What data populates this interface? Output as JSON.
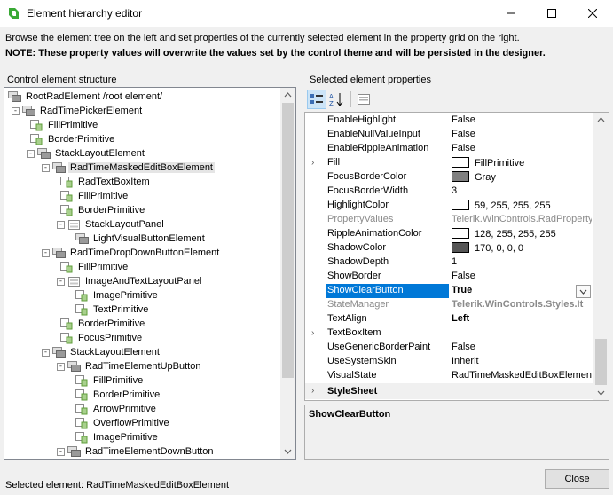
{
  "window": {
    "title": "Element hierarchy editor"
  },
  "description": {
    "line1": "Browse the element tree on the left and set properties of the currently selected element in the property grid on the right.",
    "line2": "NOTE: These property values will overwrite the values set by the control theme and will be persisted in the designer."
  },
  "tree_panel": {
    "label": "Control element structure",
    "items": [
      {
        "label": "RootRadElement /root element/",
        "level": 0,
        "expander": "-",
        "icon": "element-stack-icon"
      },
      {
        "label": "RadTimePickerElement",
        "level": 1,
        "expander": "-",
        "icon": "element-stack-icon"
      },
      {
        "label": "FillPrimitive",
        "level": 2,
        "expander": "",
        "icon": "primitive-icon"
      },
      {
        "label": "BorderPrimitive",
        "level": 2,
        "expander": "",
        "icon": "primitive-icon"
      },
      {
        "label": "StackLayoutElement",
        "level": 2,
        "expander": "-",
        "icon": "element-stack-icon"
      },
      {
        "label": "RadTimeMaskedEditBoxElement",
        "level": 3,
        "expander": "-",
        "icon": "element-stack-icon",
        "selected": true
      },
      {
        "label": "RadTextBoxItem",
        "level": 4,
        "expander": "",
        "icon": "primitive-icon"
      },
      {
        "label": "FillPrimitive",
        "level": 4,
        "expander": "",
        "icon": "primitive-icon"
      },
      {
        "label": "BorderPrimitive",
        "level": 4,
        "expander": "",
        "icon": "primitive-icon"
      },
      {
        "label": "StackLayoutPanel",
        "level": 4,
        "expander": "-",
        "icon": "layout-panel-icon"
      },
      {
        "label": "LightVisualButtonElement",
        "level": 5,
        "expander": "",
        "icon": "element-stack-icon"
      },
      {
        "label": "RadTimeDropDownButtonElement",
        "level": 3,
        "expander": "-",
        "icon": "element-stack-icon"
      },
      {
        "label": "FillPrimitive",
        "level": 4,
        "expander": "",
        "icon": "primitive-icon"
      },
      {
        "label": "ImageAndTextLayoutPanel",
        "level": 4,
        "expander": "-",
        "icon": "layout-panel-icon"
      },
      {
        "label": "ImagePrimitive",
        "level": 5,
        "expander": "",
        "icon": "primitive-icon"
      },
      {
        "label": "TextPrimitive",
        "level": 5,
        "expander": "",
        "icon": "primitive-icon"
      },
      {
        "label": "BorderPrimitive",
        "level": 4,
        "expander": "",
        "icon": "primitive-icon"
      },
      {
        "label": "FocusPrimitive",
        "level": 4,
        "expander": "",
        "icon": "primitive-icon"
      },
      {
        "label": "StackLayoutElement",
        "level": 3,
        "expander": "-",
        "icon": "element-stack-icon"
      },
      {
        "label": "RadTimeElementUpButton",
        "level": 4,
        "expander": "-",
        "icon": "element-stack-icon"
      },
      {
        "label": "FillPrimitive",
        "level": 5,
        "expander": "",
        "icon": "primitive-icon"
      },
      {
        "label": "BorderPrimitive",
        "level": 5,
        "expander": "",
        "icon": "primitive-icon"
      },
      {
        "label": "ArrowPrimitive",
        "level": 5,
        "expander": "",
        "icon": "primitive-icon"
      },
      {
        "label": "OverflowPrimitive",
        "level": 5,
        "expander": "",
        "icon": "primitive-icon"
      },
      {
        "label": "ImagePrimitive",
        "level": 5,
        "expander": "",
        "icon": "primitive-icon"
      },
      {
        "label": "RadTimeElementDownButton",
        "level": 4,
        "expander": "-",
        "icon": "element-stack-icon"
      }
    ]
  },
  "props_panel": {
    "label": "Selected element properties",
    "toolbar": {
      "categorized_icon": "categorized-icon",
      "alphabetical_icon": "sort-az-icon",
      "property_pages_icon": "property-pages-icon"
    },
    "rows": [
      {
        "name": "EnableHighlight",
        "value": "False"
      },
      {
        "name": "EnableNullValueInput",
        "value": "False"
      },
      {
        "name": "EnableRippleAnimation",
        "value": "False"
      },
      {
        "name": "Fill",
        "value": "FillPrimitive",
        "expandable": true,
        "swatch": "#ffffff"
      },
      {
        "name": "FocusBorderColor",
        "value": "Gray",
        "swatch": "#808080"
      },
      {
        "name": "FocusBorderWidth",
        "value": "3"
      },
      {
        "name": "HighlightColor",
        "value": "59, 255, 255, 255",
        "swatch": "#ffffff"
      },
      {
        "name": "PropertyValues",
        "value": "Telerik.WinControls.RadPropertyV",
        "disabled": true
      },
      {
        "name": "RippleAnimationColor",
        "value": "128, 255, 255, 255",
        "swatch": "#ffffff"
      },
      {
        "name": "ShadowColor",
        "value": "170, 0, 0, 0",
        "swatch": "#555555"
      },
      {
        "name": "ShadowDepth",
        "value": "1"
      },
      {
        "name": "ShowBorder",
        "value": "False"
      },
      {
        "name": "ShowClearButton",
        "value": "True",
        "selected": true,
        "bold": true,
        "dropdown": true
      },
      {
        "name": "StateManager",
        "value": "Telerik.WinControls.Styles.It",
        "disabled": true,
        "bold": true
      },
      {
        "name": "TextAlign",
        "value": "Left",
        "bold": true
      },
      {
        "name": "TextBoxItem",
        "value": "",
        "expandable": true
      },
      {
        "name": "UseGenericBorderPaint",
        "value": "False"
      },
      {
        "name": "UseSystemSkin",
        "value": "Inherit"
      },
      {
        "name": "VisualState",
        "value": "RadTimeMaskedEditBoxElement"
      }
    ],
    "category": "StyleSheet",
    "description_title": "ShowClearButton"
  },
  "footer": {
    "status": "Selected element: RadTimeMaskedEditBoxElement",
    "close_label": "Close"
  },
  "colors": {
    "selection": "#0078d7",
    "tree_selection": "#e5e5e5",
    "accent_green": "#3aa935"
  }
}
